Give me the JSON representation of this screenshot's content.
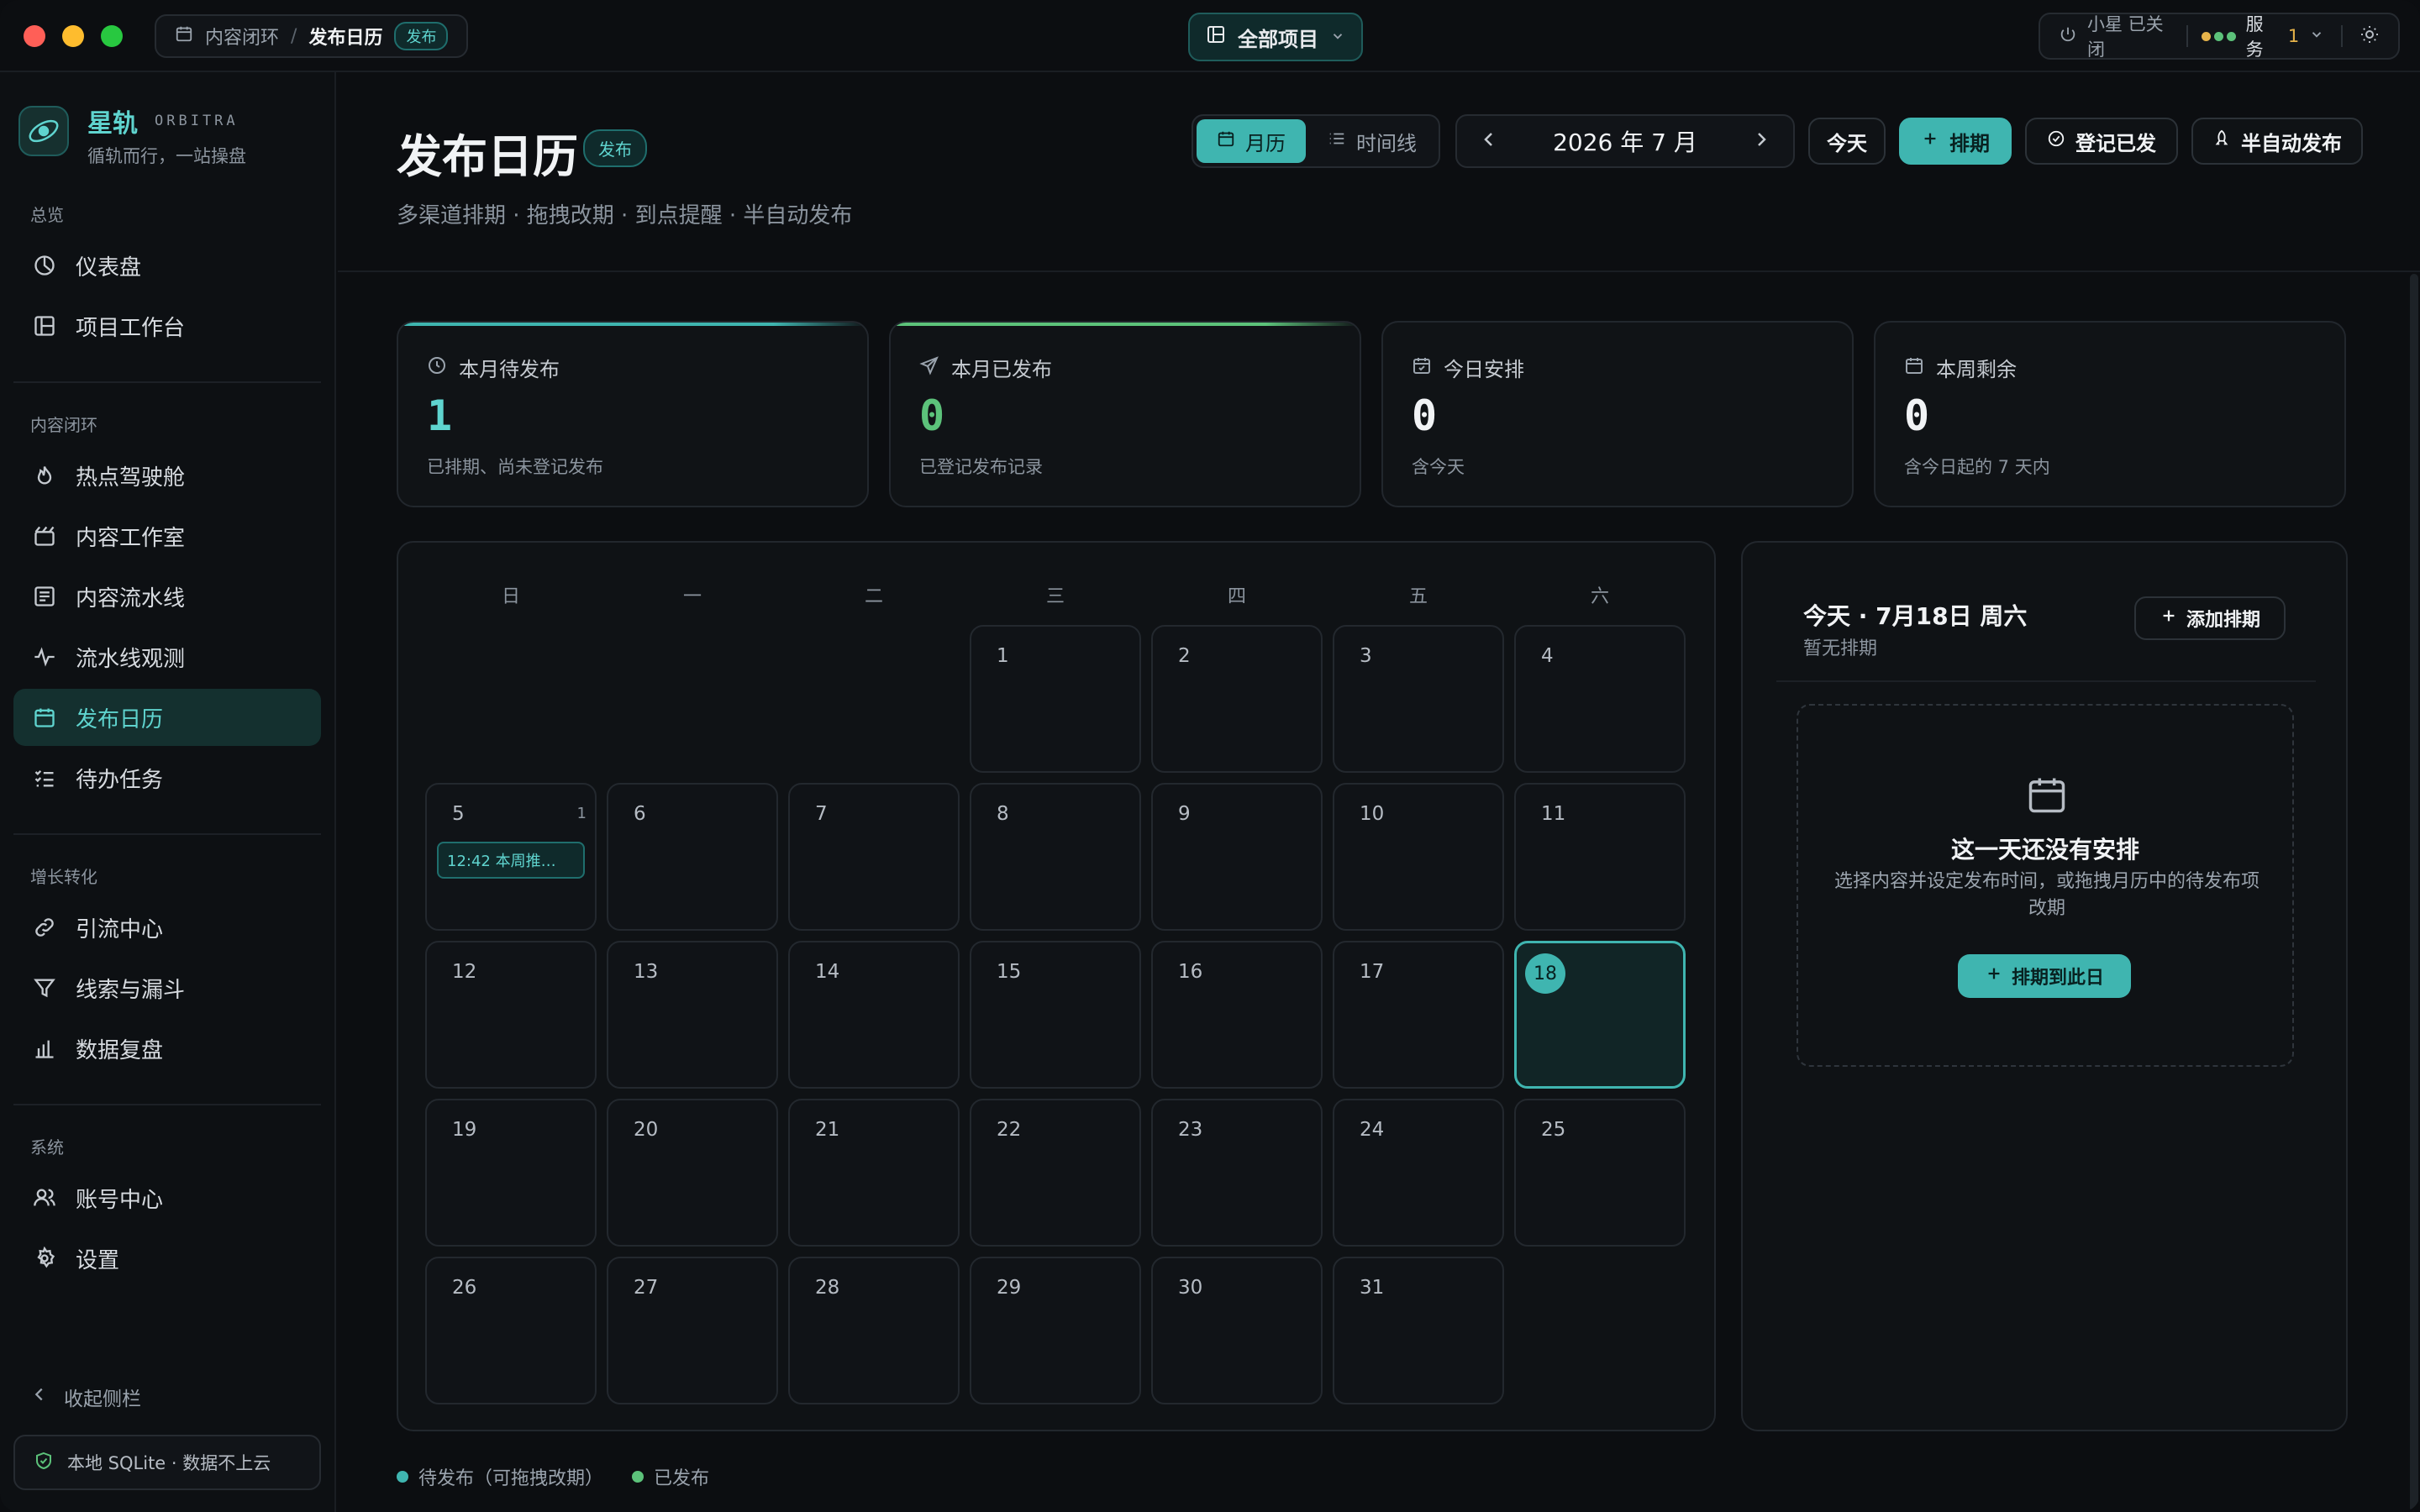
{
  "titlebar": {
    "breadcrumb_parent": "内容闭环",
    "breadcrumb_sep": "/",
    "breadcrumb_current": "发布日历",
    "breadcrumb_badge": "发布",
    "project_selector": "全部项目",
    "assistant_status": "小星 已关闭",
    "service_label": "服务",
    "service_count": "1"
  },
  "sidebar": {
    "brand": "星轨",
    "brand_en": "ORBITRA",
    "slogan": "循轨而行，一站操盘",
    "sections": [
      {
        "title": "总览",
        "items": [
          {
            "label": "仪表盘",
            "icon": "dashboard-icon"
          },
          {
            "label": "项目工作台",
            "icon": "workspace-icon"
          }
        ]
      },
      {
        "title": "内容闭环",
        "items": [
          {
            "label": "热点驾驶舱",
            "icon": "flame-icon"
          },
          {
            "label": "内容工作室",
            "icon": "studio-icon"
          },
          {
            "label": "内容流水线",
            "icon": "pipeline-icon"
          },
          {
            "label": "流水线观测",
            "icon": "pulse-icon"
          },
          {
            "label": "发布日历",
            "icon": "calendar-icon"
          },
          {
            "label": "待办任务",
            "icon": "tasks-icon"
          }
        ]
      },
      {
        "title": "增长转化",
        "items": [
          {
            "label": "引流中心",
            "icon": "link-icon"
          },
          {
            "label": "线索与漏斗",
            "icon": "funnel-icon"
          },
          {
            "label": "数据复盘",
            "icon": "bar-chart-icon"
          }
        ]
      },
      {
        "title": "系统",
        "items": [
          {
            "label": "账号中心",
            "icon": "users-icon"
          },
          {
            "label": "设置",
            "icon": "gear-icon"
          }
        ]
      }
    ],
    "collapse_label": "收起侧栏",
    "local_storage_note": "本地 SQLite · 数据不上云"
  },
  "header": {
    "title": "发布日历",
    "badge": "发布",
    "subtitle": "多渠道排期 · 拖拽改期 · 到点提醒 · 半自动发布",
    "view_month": "月历",
    "view_timeline": "时间线",
    "month_label": "2026 年 7 月",
    "today_button": "今天",
    "schedule_button": "排期",
    "mark_published_button": "登记已发",
    "semi_auto_button": "半自动发布"
  },
  "stats": [
    {
      "label": "本月待发布",
      "value": "1",
      "desc": "已排期、尚未登记发布",
      "color": "#5fd4cf"
    },
    {
      "label": "本月已发布",
      "value": "0",
      "desc": "已登记发布记录",
      "color": "#5cc27a"
    },
    {
      "label": "今日安排",
      "value": "0",
      "desc": "含今天",
      "color": "#f1f3f5"
    },
    {
      "label": "本周剩余",
      "value": "0",
      "desc": "含今日起的 7 天内",
      "color": "#f1f3f5"
    }
  ],
  "calendar": {
    "weekdays": [
      "日",
      "一",
      "二",
      "三",
      "四",
      "五",
      "六"
    ],
    "first_weekday": 3,
    "days_in_month": 31,
    "today": 18,
    "events": [
      {
        "day": 5,
        "count": "1",
        "text": "12:42 本周推…"
      }
    ]
  },
  "panel": {
    "title": "今天 · 7月18日 周六",
    "subtitle": "暂无排期",
    "add_button": "添加排期",
    "empty_title": "这一天还没有安排",
    "empty_desc": "选择内容并设定发布时间，或拖拽月历中的待发布项改期",
    "empty_button": "排期到此日"
  },
  "legend": [
    {
      "label": "待发布（可拖拽改期）",
      "color": "#3fb5b0"
    },
    {
      "label": "已发布",
      "color": "#5cc27a"
    }
  ]
}
